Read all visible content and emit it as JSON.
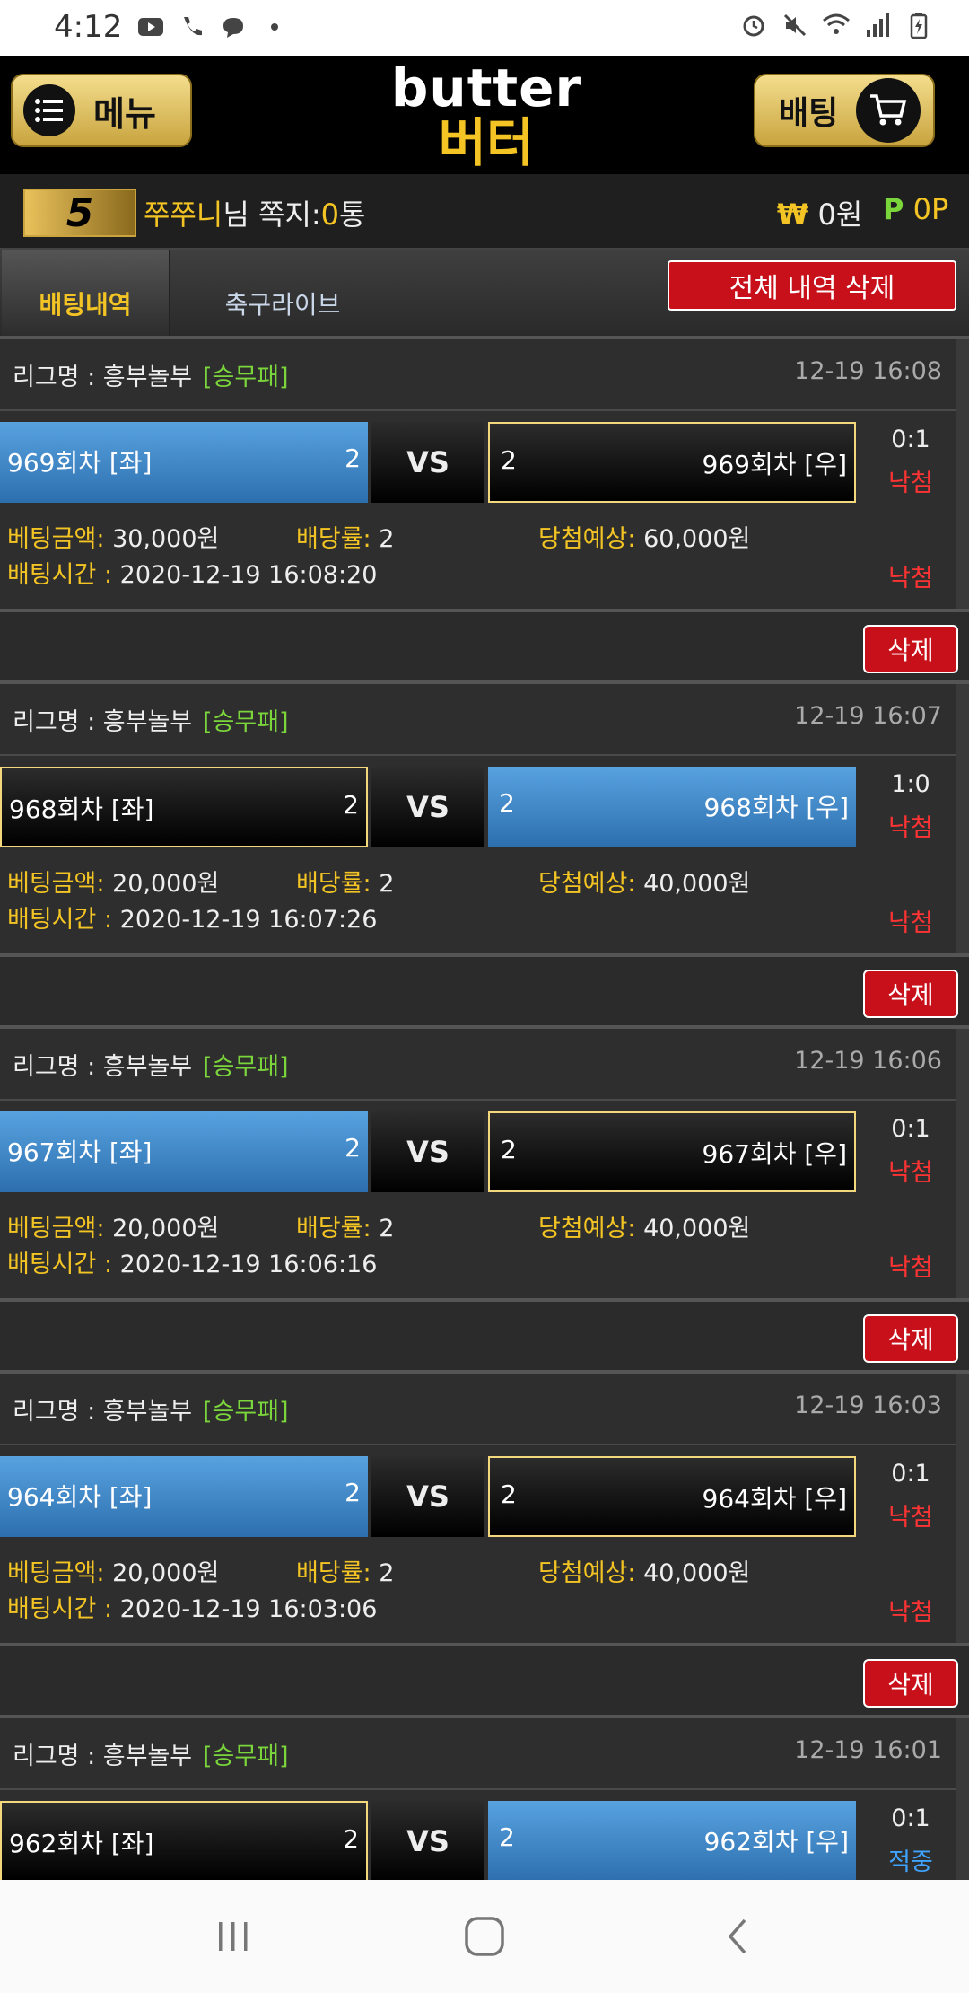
{
  "status": {
    "time": "4:12"
  },
  "header": {
    "menu_label": "메뉴",
    "bet_label": "배팅",
    "logo_en": "butter",
    "logo_ko": "버터"
  },
  "user": {
    "level": "5",
    "name": "쭈쭈니",
    "name_suffix": "님",
    "msg_label": "쪽지:",
    "msg_count": "0",
    "msg_unit": "통",
    "money_symbol": "₩",
    "money": "0원",
    "point_symbol": "P",
    "points": "0P"
  },
  "tabs": {
    "history": "배팅내역",
    "live": "축구라이브",
    "delete_all": "전체 내역 삭제"
  },
  "labels": {
    "league": "리그명 : 흥부놀부",
    "vs": "VS",
    "amount": "베팅금액:",
    "rate": "배당률:",
    "expect": "당첨예상:",
    "time": "배팅시간 :",
    "delete": "삭제"
  },
  "bets": [
    {
      "type": "[승무패]",
      "time": "12-19 16:08",
      "left": "969회차 [좌]",
      "left_odd": "2",
      "right": "969회차 [우]",
      "right_odd": "2",
      "selected": "left",
      "score": "0:1",
      "result": "낙첨",
      "amount": "30,000원",
      "rate": "2",
      "expect": "60,000원",
      "bet_time": "2020-12-19 16:08:20",
      "result2": "낙첨"
    },
    {
      "type": "[승무패]",
      "time": "12-19 16:07",
      "left": "968회차 [좌]",
      "left_odd": "2",
      "right": "968회차 [우]",
      "right_odd": "2",
      "selected": "right",
      "score": "1:0",
      "result": "낙첨",
      "amount": "20,000원",
      "rate": "2",
      "expect": "40,000원",
      "bet_time": "2020-12-19 16:07:26",
      "result2": "낙첨"
    },
    {
      "type": "[승무패]",
      "time": "12-19 16:06",
      "left": "967회차 [좌]",
      "left_odd": "2",
      "right": "967회차 [우]",
      "right_odd": "2",
      "selected": "left",
      "score": "0:1",
      "result": "낙첨",
      "amount": "20,000원",
      "rate": "2",
      "expect": "40,000원",
      "bet_time": "2020-12-19 16:06:16",
      "result2": "낙첨"
    },
    {
      "type": "[승무패]",
      "time": "12-19 16:03",
      "left": "964회차 [좌]",
      "left_odd": "2",
      "right": "964회차 [우]",
      "right_odd": "2",
      "selected": "left",
      "score": "0:1",
      "result": "낙첨",
      "amount": "20,000원",
      "rate": "2",
      "expect": "40,000원",
      "bet_time": "2020-12-19 16:03:06",
      "result2": "낙첨"
    },
    {
      "type": "[승무패]",
      "time": "12-19 16:01",
      "left": "962회차 [좌]",
      "left_odd": "2",
      "right": "962회차 [우]",
      "right_odd": "2",
      "selected": "right",
      "score": "0:1",
      "result": "적중",
      "amount": "",
      "rate": "",
      "expect": "",
      "bet_time": "",
      "result2": ""
    }
  ],
  "colors": {
    "accent": "#f3c423",
    "selected_blue": "#3f86c8",
    "lose_red": "#ff3333",
    "win_blue": "#3fa3ff",
    "delete_red": "#c8101a"
  },
  "icons": {
    "menu": "hamburger-icon",
    "cart": "cart-icon",
    "nav_recent": "recent-apps-icon",
    "nav_home": "home-icon",
    "nav_back": "back-icon"
  }
}
